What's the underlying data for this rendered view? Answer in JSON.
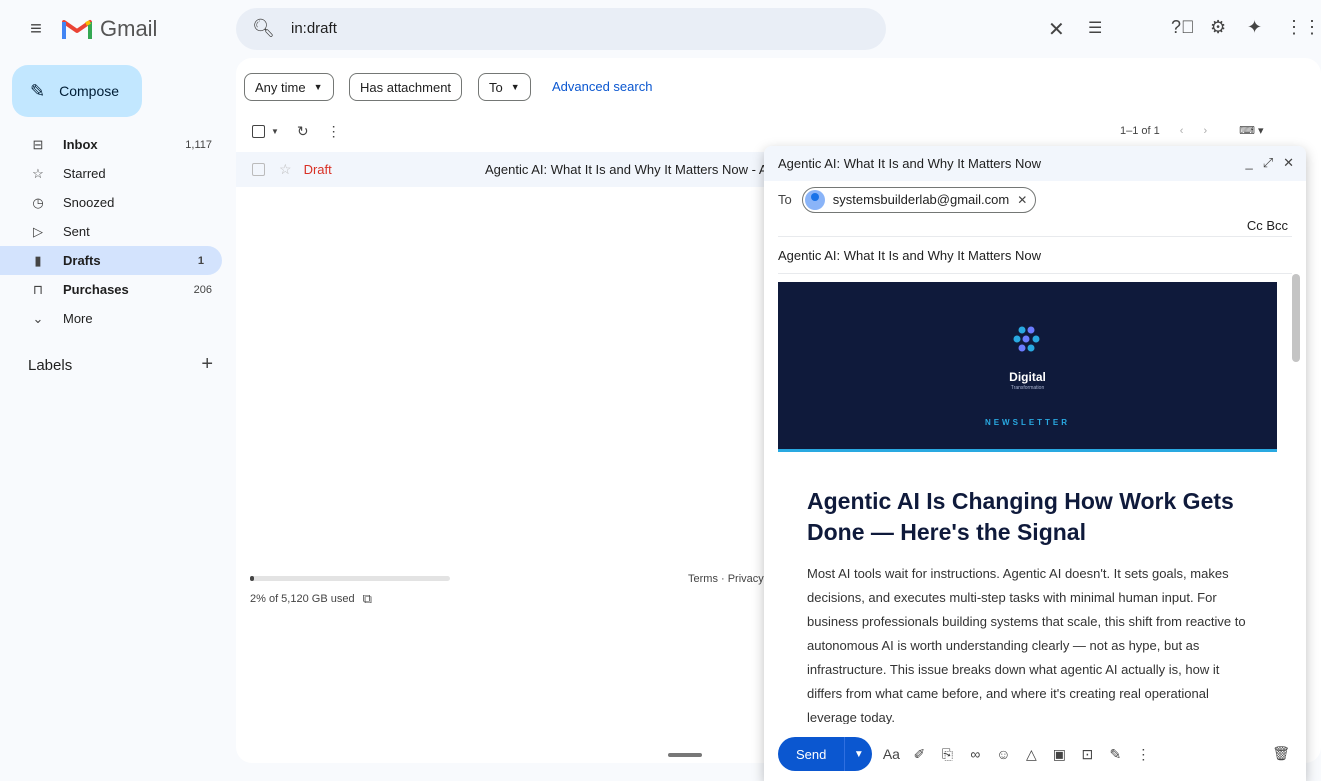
{
  "app": {
    "name": "Gmail"
  },
  "search": {
    "query": "in:draft"
  },
  "compose_label": "Compose",
  "nav": [
    {
      "label": "Inbox",
      "count": "1,117",
      "icon": "inbox-icon",
      "glyph": "⊟",
      "bold": true
    },
    {
      "label": "Starred",
      "count": "",
      "icon": "star-icon",
      "glyph": "☆",
      "bold": false
    },
    {
      "label": "Snoozed",
      "count": "",
      "icon": "clock-icon",
      "glyph": "◷",
      "bold": false
    },
    {
      "label": "Sent",
      "count": "",
      "icon": "send-icon",
      "glyph": "▷",
      "bold": false
    },
    {
      "label": "Drafts",
      "count": "1",
      "icon": "draft-icon",
      "glyph": "▮",
      "bold": true,
      "active": true
    },
    {
      "label": "Purchases",
      "count": "206",
      "icon": "purchases-icon",
      "glyph": "⊓",
      "bold": true
    },
    {
      "label": "More",
      "count": "",
      "icon": "chevron-down-icon",
      "glyph": "⌄",
      "bold": false
    }
  ],
  "labels": {
    "title": "Labels"
  },
  "filters": {
    "any_time": "Any time",
    "has_attachment": "Has attachment",
    "to": "To",
    "advanced": "Advanced search"
  },
  "pager": {
    "range": "1–1 of 1"
  },
  "row": {
    "tag": "Draft",
    "subject": "Agentic AI: What It Is and Why It Matters Now - A"
  },
  "storage": {
    "text": "2% of 5,120 GB used",
    "fraction": 0.02
  },
  "footer": {
    "terms": "Terms · Privacy"
  },
  "compose_window": {
    "title": "Agentic AI: What It Is and Why It Matters Now",
    "to_label": "To",
    "recipient": "systemsbuilderlab@gmail.com",
    "cc_bcc": "Cc Bcc",
    "subject": "Agentic AI: What It Is and Why It Matters Now",
    "banner": {
      "brand": "Digital",
      "brand_sub": "Transformation",
      "tag": "NEWSLETTER"
    },
    "headline": "Agentic AI Is Changing How Work Gets Done — Here's the Signal",
    "paragraph": "Most AI tools wait for instructions. Agentic AI doesn't. It sets goals, makes decisions, and executes multi-step tasks with minimal human input. For business professionals building systems that scale, this shift from reactive to autonomous AI is worth understanding clearly — not as hype, but as infrastructure. This issue breaks down what agentic AI actually is, how it differs from what came before, and where it's creating real operational leverage today.",
    "send_label": "Send"
  },
  "colors": {
    "accent": "#0b57d0",
    "compose_bg": "#c2e7ff",
    "active_nav": "#d3e3fd",
    "draft_red": "#d93025",
    "banner_bg": "#0f1a3b",
    "banner_accent": "#29a9e1"
  }
}
